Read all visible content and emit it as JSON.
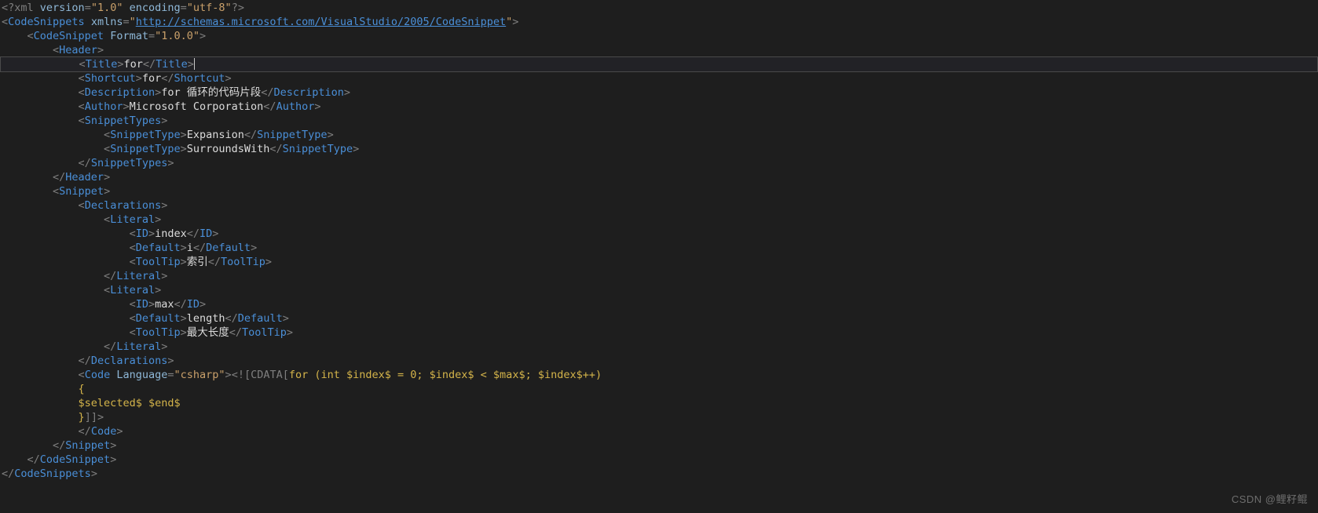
{
  "editor": {
    "language": "xml",
    "theme": "dark",
    "background_color": "#1e1e1e",
    "current_line_number": 5,
    "colors": {
      "tag": "#4a8fd8",
      "punctuation": "#7f7f7f",
      "attribute_name": "#8fb8d8",
      "attribute_value": "#c9a06a",
      "text": "#dcdcdc",
      "link": "#4a8fd8",
      "cdata_code": "#d4b44a",
      "current_line_border": "#4a4a4a"
    }
  },
  "lines": {
    "l1": {
      "decl_open": "<?xml ",
      "attr1": "version",
      "eq1": "=",
      "val1": "\"1.0\"",
      "space": " ",
      "attr2": "encoding",
      "eq2": "=",
      "val2": "\"utf-8\"",
      "decl_close": "?>"
    },
    "l2": {
      "open": "<",
      "tag": "CodeSnippets",
      "sp": " ",
      "attr": "xmlns",
      "eq": "=",
      "quote_open": "\"",
      "url": "http://schemas.microsoft.com/VisualStudio/2005/CodeSnippet",
      "quote_close": "\"",
      "close": ">"
    },
    "l3": {
      "indent": "    ",
      "open": "<",
      "tag": "CodeSnippet",
      "sp": " ",
      "attr": "Format",
      "eq": "=",
      "val": "\"1.0.0\"",
      "close": ">"
    },
    "l4": {
      "indent": "        ",
      "open": "<",
      "tag": "Header",
      "close": ">"
    },
    "l5": {
      "indent": "            ",
      "open": "<",
      "tag": "Title",
      "gt": ">",
      "text": "for",
      "close_open": "</",
      "close_tag": "Title",
      "close_gt": ">"
    },
    "l6": {
      "indent": "            ",
      "open": "<",
      "tag": "Shortcut",
      "gt": ">",
      "text": "for",
      "close_open": "</",
      "close_tag": "Shortcut",
      "close_gt": ">"
    },
    "l7": {
      "indent": "            ",
      "open": "<",
      "tag": "Description",
      "gt": ">",
      "text": "for 循环的代码片段",
      "close_open": "</",
      "close_tag": "Description",
      "close_gt": ">"
    },
    "l8": {
      "indent": "            ",
      "open": "<",
      "tag": "Author",
      "gt": ">",
      "text": "Microsoft Corporation",
      "close_open": "</",
      "close_tag": "Author",
      "close_gt": ">"
    },
    "l9": {
      "indent": "            ",
      "open": "<",
      "tag": "SnippetTypes",
      "close": ">"
    },
    "l10": {
      "indent": "                ",
      "open": "<",
      "tag": "SnippetType",
      "gt": ">",
      "text": "Expansion",
      "close_open": "</",
      "close_tag": "SnippetType",
      "close_gt": ">"
    },
    "l11": {
      "indent": "                ",
      "open": "<",
      "tag": "SnippetType",
      "gt": ">",
      "text": "SurroundsWith",
      "close_open": "</",
      "close_tag": "SnippetType",
      "close_gt": ">"
    },
    "l12": {
      "indent": "            ",
      "open": "</",
      "tag": "SnippetTypes",
      "close": ">"
    },
    "l13": {
      "indent": "        ",
      "open": "</",
      "tag": "Header",
      "close": ">"
    },
    "l14": {
      "indent": "        ",
      "open": "<",
      "tag": "Snippet",
      "close": ">"
    },
    "l15": {
      "indent": "            ",
      "open": "<",
      "tag": "Declarations",
      "close": ">"
    },
    "l16": {
      "indent": "                ",
      "open": "<",
      "tag": "Literal",
      "close": ">"
    },
    "l17": {
      "indent": "                    ",
      "open": "<",
      "tag": "ID",
      "gt": ">",
      "text": "index",
      "close_open": "</",
      "close_tag": "ID",
      "close_gt": ">"
    },
    "l18": {
      "indent": "                    ",
      "open": "<",
      "tag": "Default",
      "gt": ">",
      "text": "i",
      "close_open": "</",
      "close_tag": "Default",
      "close_gt": ">"
    },
    "l19": {
      "indent": "                    ",
      "open": "<",
      "tag": "ToolTip",
      "gt": ">",
      "text": "索引",
      "close_open": "</",
      "close_tag": "ToolTip",
      "close_gt": ">"
    },
    "l20": {
      "indent": "                ",
      "open": "</",
      "tag": "Literal",
      "close": ">"
    },
    "l21": {
      "indent": "                ",
      "open": "<",
      "tag": "Literal",
      "close": ">"
    },
    "l22": {
      "indent": "                    ",
      "open": "<",
      "tag": "ID",
      "gt": ">",
      "text": "max",
      "close_open": "</",
      "close_tag": "ID",
      "close_gt": ">"
    },
    "l23": {
      "indent": "                    ",
      "open": "<",
      "tag": "Default",
      "gt": ">",
      "text": "length",
      "close_open": "</",
      "close_tag": "Default",
      "close_gt": ">"
    },
    "l24": {
      "indent": "                    ",
      "open": "<",
      "tag": "ToolTip",
      "gt": ">",
      "text": "最大长度",
      "close_open": "</",
      "close_tag": "ToolTip",
      "close_gt": ">"
    },
    "l25": {
      "indent": "                ",
      "open": "</",
      "tag": "Literal",
      "close": ">"
    },
    "l26": {
      "indent": "            ",
      "open": "</",
      "tag": "Declarations",
      "close": ">"
    },
    "l27": {
      "indent": "            ",
      "open": "<",
      "tag": "Code",
      "sp": " ",
      "attr": "Language",
      "eq": "=",
      "val": "\"csharp\"",
      "gt": ">",
      "cdata_open": "<![CDATA[",
      "code": "for (int $index$ = 0; $index$ < $max$; $index$++)"
    },
    "l28": {
      "indent": "            ",
      "code": "{"
    },
    "l29": {
      "indent": "            ",
      "code": "$selected$ $end$"
    },
    "l30": {
      "indent": "            ",
      "code": "}",
      "cdata_close": "]]>"
    },
    "l31": {
      "indent": "            ",
      "open": "</",
      "tag": "Code",
      "close": ">"
    },
    "l32": {
      "indent": "        ",
      "open": "</",
      "tag": "Snippet",
      "close": ">"
    },
    "l33": {
      "indent": "    ",
      "open": "</",
      "tag": "CodeSnippet",
      "close": ">"
    },
    "l34": {
      "indent": "",
      "open": "</",
      "tag": "CodeSnippets",
      "close": ">"
    }
  },
  "watermark": {
    "text": "CSDN @鲤籽鲲"
  }
}
